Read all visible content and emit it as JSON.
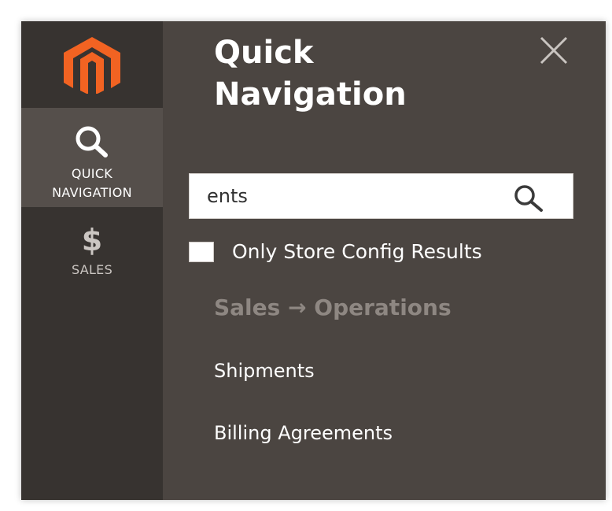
{
  "sidebar": {
    "logo_icon": "magento-logo-icon",
    "logo_color": "#f26322",
    "items": [
      {
        "icon": "search-icon",
        "label": "QUICK NAVIGATION",
        "label_line1": "QUICK",
        "label_line2": "NAVIGATION",
        "active": true
      },
      {
        "icon": "dollar-icon",
        "glyph": "$",
        "label": "SALES",
        "active": false
      }
    ]
  },
  "panel": {
    "title_line1": "Quick",
    "title_line2": "Navigation",
    "close_icon": "close-icon",
    "search": {
      "value": "ents",
      "icon": "search-icon"
    },
    "checkbox": {
      "label": "Only Store Config Results",
      "checked": false
    },
    "section_heading": "Sales → Operations",
    "results": [
      "Shipments",
      "Billing Agreements"
    ]
  },
  "colors": {
    "sidebar_bg": "#373330",
    "sidebar_active_bg": "#554f4b",
    "panel_bg": "#4b4541",
    "accent": "#f26322"
  }
}
